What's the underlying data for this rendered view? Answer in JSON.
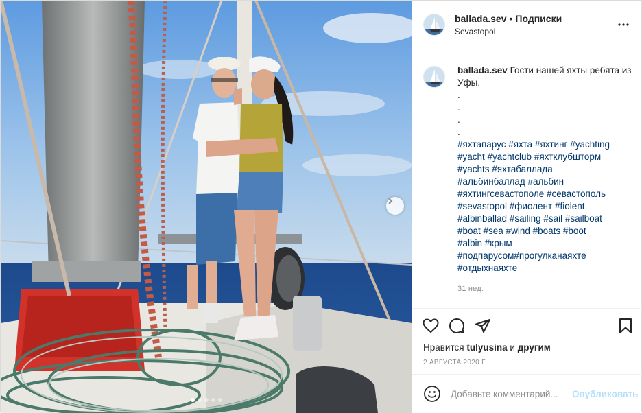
{
  "post": {
    "author": "ballada.sev",
    "separator": "•",
    "follow_label": "Подписки",
    "location": "Sevastopol",
    "caption_text": "Гости нашей яхты ребята из Уфы.",
    "caption_dots": [
      ".",
      ".",
      ".",
      "."
    ],
    "hashtag_lines": [
      "#яхтапарус #яхта #яхтинг #yachting",
      "#yacht #yachtclub #яхтклубшторм",
      "#yachts #яхтабаллада",
      "#альбинбаллад #альбин",
      "#яхтингсевастополе #севастополь",
      "#sevastopol #фиолент #fiolent",
      "#albinballad #sailing #sail #sailboat",
      "#boat #sea #wind #boats #boot",
      "#albin #крым",
      "#подпарусом#прогулканаяхте",
      "#отдыхнаяхте"
    ],
    "caption_age": "31 нед.",
    "likes_prefix": "Нравится",
    "liked_by": "tulyusina",
    "likes_and": "и",
    "likes_others": "другим",
    "date": "2 АВГУСТА 2020 Г.",
    "comment_placeholder": "Добавьте комментарий...",
    "publish_label": "Опубликовать",
    "carousel": {
      "slides": 5,
      "active_index": 0
    }
  },
  "icons": {
    "more": "more-horizontal-icon",
    "like": "heart-icon",
    "comment": "comment-icon",
    "share": "paper-plane-icon",
    "save": "bookmark-icon",
    "emoji": "smiley-icon",
    "next": "chevron-right-icon"
  },
  "colors": {
    "link": "#00376b",
    "muted": "#8e8e8e",
    "publish_disabled": "#b2dffc",
    "border": "#efefef"
  }
}
